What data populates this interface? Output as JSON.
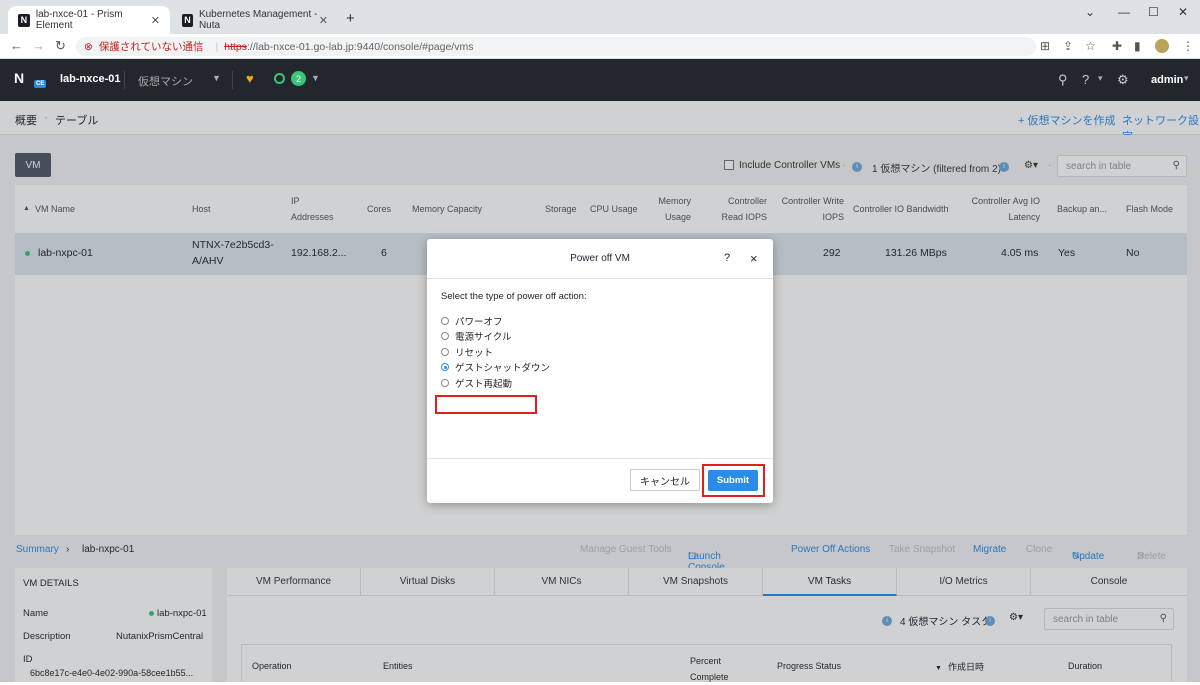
{
  "browser": {
    "tabs": [
      {
        "title": "lab-nxce-01 - Prism Element"
      },
      {
        "title": "Kubernetes Management - Nuta"
      }
    ],
    "security_label": "保護されていない通信",
    "url_scheme": "https",
    "url_rest": "://lab-nxce-01.go-lab.jp:9440/console/#page/vms"
  },
  "appbar": {
    "logo_text": "N",
    "logo_badge": "CE",
    "cluster_name": "lab-nxce-01",
    "menu_label": "仮想マシン",
    "alert_count": "2",
    "user": "admin"
  },
  "subnav": {
    "overview": "概要",
    "table": "テーブル",
    "create_vm": "+ 仮想マシンを作成",
    "network_config": "ネットワーク設定"
  },
  "toolbar": {
    "vm_button": "VM",
    "include_cvm": "Include Controller VMs",
    "summary": "1 仮想マシン (filtered from 2)",
    "search_placeholder": "search in table"
  },
  "table": {
    "headers": [
      "VM Name",
      "Host",
      "IP Addresses",
      "Cores",
      "Memory Capacity",
      "Storage",
      "CPU Usage",
      "Memory Usage",
      "Controller Read IOPS",
      "Controller Write IOPS",
      "Controller IO Bandwidth",
      "Controller Avg IO Latency",
      "Backup an...",
      "Flash Mode"
    ],
    "row": {
      "name": "lab-nxpc-01",
      "host": "NTNX-7e2b5cd3-A/AHV",
      "ip": "192.168.2...",
      "cores": "6",
      "write_iops": "292",
      "io_bandwidth": "131.26 MBps",
      "latency": "4.05 ms",
      "backup": "Yes",
      "flash": "No"
    }
  },
  "modal": {
    "title": "Power off VM",
    "help": "?",
    "close": "×",
    "prompt": "Select the type of power off action:",
    "options": [
      "パワーオフ",
      "電源サイクル",
      "リセット",
      "ゲストシャットダウン",
      "ゲスト再起動"
    ],
    "selected_index": 3,
    "cancel": "キャンセル",
    "submit": "Submit"
  },
  "details": {
    "breadcrumb_root": "Summary",
    "breadcrumb_vm": "lab-nxpc-01",
    "actions": [
      "Manage Guest Tools",
      "Launch Console",
      "Power Off Actions",
      "Take Snapshot",
      "Migrate",
      "Clone",
      "Update",
      "Delete"
    ],
    "panel_title": "VM DETAILS",
    "name_label": "Name",
    "name_value": "lab-nxpc-01",
    "desc_label": "Description",
    "desc_value": "NutanixPrismCentral",
    "id_label": "ID",
    "id_value": "6bc8e17c-e4e0-4e02-990a-58cee1b55..."
  },
  "detail_tabs": [
    "VM Performance",
    "Virtual Disks",
    "VM NICs",
    "VM Snapshots",
    "VM Tasks",
    "I/O Metrics",
    "Console"
  ],
  "tasks": {
    "summary": "4 仮想マシン タスク",
    "search_placeholder": "search in table",
    "headers": [
      "Operation",
      "Entities",
      "Percent Complete",
      "Progress Status",
      "作成日時",
      "Duration"
    ]
  }
}
